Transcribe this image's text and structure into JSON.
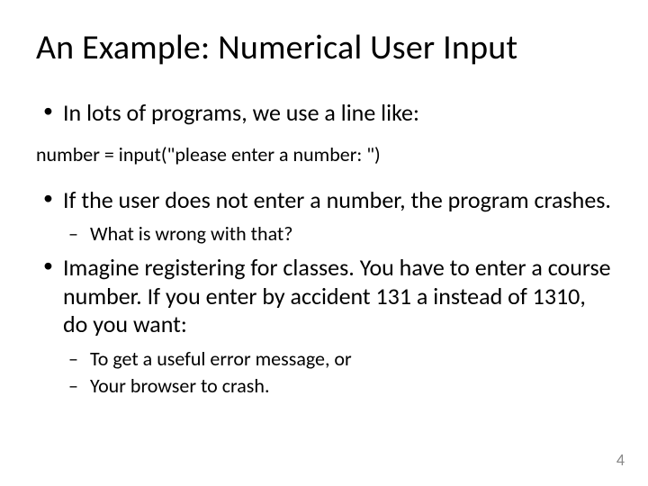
{
  "title": "An Example: Numerical User Input",
  "bullets": {
    "b1": "In lots of programs, we use a line like:",
    "code": "number = input(\"please enter a number: \")",
    "b2": "If the user does not enter a number, the program crashes.",
    "b2_sub1": "What is wrong with that?",
    "b3": "Imagine registering for classes. You have to enter a course number. If you enter by accident 131 a instead of 1310, do you want:",
    "b3_sub1": "To get a useful error message, or",
    "b3_sub2": "Your browser to crash."
  },
  "page_number": "4"
}
